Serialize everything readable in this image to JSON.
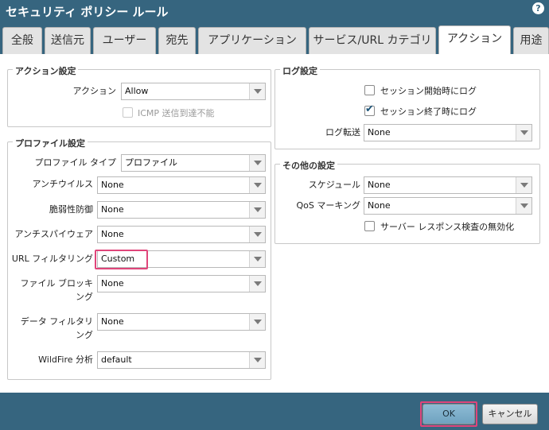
{
  "window": {
    "title": "セキュリティ ポリシー ルール"
  },
  "tabs": [
    "全般",
    "送信元",
    "ユーザー",
    "宛先",
    "アプリケーション",
    "サービス/URL カテゴリ",
    "アクション",
    "用途"
  ],
  "active_tab": "アクション",
  "action_settings": {
    "legend": "アクション設定",
    "action_label": "アクション",
    "action_value": "Allow",
    "icmp_label": "ICMP 送信到達不能",
    "icmp_checked": false,
    "icmp_disabled": true
  },
  "profile_settings": {
    "legend": "プロファイル設定",
    "fields": [
      {
        "label": "プロファイル タイプ",
        "value": "プロファイル"
      },
      {
        "label": "アンチウイルス",
        "value": "None"
      },
      {
        "label": "脆弱性防御",
        "value": "None"
      },
      {
        "label": "アンチスパイウェア",
        "value": "None"
      },
      {
        "label": "URL フィルタリング",
        "value": "Custom"
      },
      {
        "label_line1": "ファイル ブロッキ",
        "label_line2": "ング",
        "value": "None"
      },
      {
        "label_line1": "データ フィルタリ",
        "label_line2": "ング",
        "value": "None"
      },
      {
        "label": "WildFire 分析",
        "value": "default"
      }
    ]
  },
  "log_settings": {
    "legend": "ログ設定",
    "log_start_label": "セッション開始時にログ",
    "log_start_checked": false,
    "log_end_label": "セッション終了時にログ",
    "log_end_checked": true,
    "forward_label": "ログ転送",
    "forward_value": "None"
  },
  "other_settings": {
    "legend": "その他の設定",
    "schedule_label": "スケジュール",
    "schedule_value": "None",
    "qos_label": "QoS マーキング",
    "qos_value": "None",
    "disable_srv_label": "サーバー レスポンス検査の無効化",
    "disable_srv_checked": false
  },
  "footer": {
    "ok_label": "OK",
    "cancel_label": "キャンセル"
  },
  "colors": {
    "frame": "#36657f",
    "highlight": "#e0457a",
    "ok_button": "#7fb0cc"
  }
}
